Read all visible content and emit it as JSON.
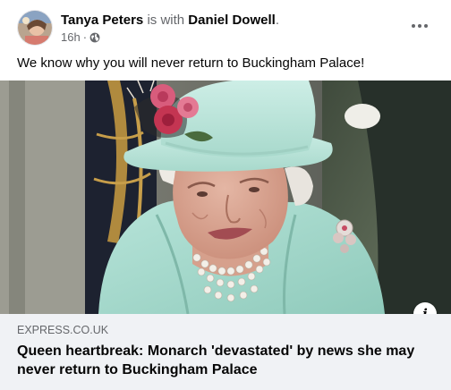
{
  "post": {
    "author": "Tanya Peters",
    "with_text": " is with ",
    "tagged": "Daniel Dowell",
    "tagged_suffix": ".",
    "time": "16h",
    "separator": "·",
    "privacy_icon": "globe-icon",
    "more_icon": "more-options-icon",
    "text": "We know why you will never return to Buckingham Palace!"
  },
  "link": {
    "domain": "EXPRESS.CO.UK",
    "title": "Queen heartbreak: Monarch 'devastated' by news she may never return to Buckingham Palace",
    "info_icon": "info-icon",
    "info_glyph": "i"
  },
  "colors": {
    "text_primary": "#050505",
    "text_secondary": "#65676b",
    "card_background": "#f0f2f5",
    "hat": "#bfe6dc",
    "coat": "#a9dcd0"
  }
}
